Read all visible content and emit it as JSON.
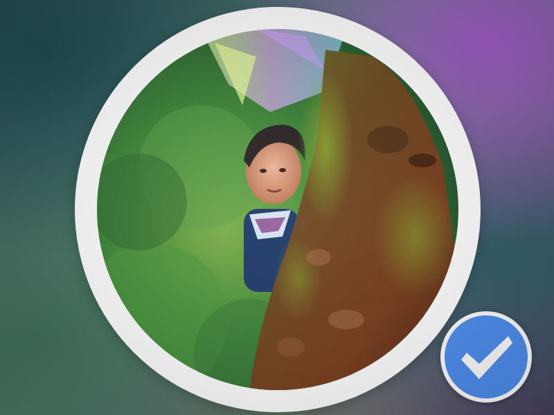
{
  "profile": {
    "avatar_icon": "profile-photo",
    "ring_color": "#ffffff",
    "verified": true,
    "verified_icon": "checkmark-icon",
    "badge_color": "#4d8ef0"
  }
}
